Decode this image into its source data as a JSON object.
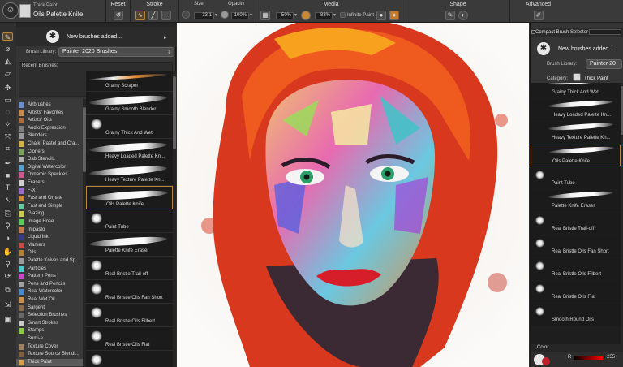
{
  "topbar": {
    "brush_category": "Thick Paint",
    "brush_variant": "Oils Palette Knife",
    "reset_label": "Reset",
    "stroke_label": "Stroke",
    "size_label": "Size",
    "size_value": "33.1",
    "opacity_label": "Opacity",
    "opacity_value": "100%",
    "media_label": "Media",
    "media_value_1": "50%",
    "media_value_2": "83%",
    "infinite_paint_label": "Infinite Paint",
    "shape_label": "Shape",
    "advanced_label": "Advanced"
  },
  "brush_panel": {
    "news_text": "New brushes added...",
    "library_label": "Brush Library:",
    "library_value": "Painter 2020 Brushes",
    "recent_label": "Recent Brushes:",
    "categories": [
      {
        "label": "Airbrushes",
        "color": "#6a8fc9"
      },
      {
        "label": "Artists' Favorites",
        "color": "#c98a4a"
      },
      {
        "label": "Artists' Oils",
        "color": "#b36b3a"
      },
      {
        "label": "Audio Expression",
        "color": "#7f7f7f"
      },
      {
        "label": "Blenders",
        "color": "#9a9a9a"
      },
      {
        "label": "Chalk, Pastel and Cra...",
        "color": "#d6b04e"
      },
      {
        "label": "Cloners",
        "color": "#7aa35b"
      },
      {
        "label": "Dab Stencils",
        "color": "#b0b0b0"
      },
      {
        "label": "Digital Watercolor",
        "color": "#5aa0c9"
      },
      {
        "label": "Dynamic Speckles",
        "color": "#c95a8f"
      },
      {
        "label": "Erasers",
        "color": "#d0d0d0"
      },
      {
        "label": "F-X",
        "color": "#9b6ad0"
      },
      {
        "label": "Fast and Ornate",
        "color": "#d08a3a"
      },
      {
        "label": "Fast and Simple",
        "color": "#6ac9a0"
      },
      {
        "label": "Glazing",
        "color": "#c9c95a"
      },
      {
        "label": "Image Hose",
        "color": "#5ac95a"
      },
      {
        "label": "Impasto",
        "color": "#c97a4a"
      },
      {
        "label": "Liquid Ink",
        "color": "#3a3a8a"
      },
      {
        "label": "Markers",
        "color": "#c94a4a"
      },
      {
        "label": "Oils",
        "color": "#b0803a"
      },
      {
        "label": "Palette Knives and Sp...",
        "color": "#9a9a9a"
      },
      {
        "label": "Particles",
        "color": "#4ac9c9"
      },
      {
        "label": "Pattern Pens",
        "color": "#c94ac9"
      },
      {
        "label": "Pens and Pencils",
        "color": "#a0a0a0"
      },
      {
        "label": "Real Watercolor",
        "color": "#4a8ac9"
      },
      {
        "label": "Real Wet Oil",
        "color": "#c9904a"
      },
      {
        "label": "Sargent",
        "color": "#8a6a4a"
      },
      {
        "label": "Selection Brushes",
        "color": "#6a6a6a"
      },
      {
        "label": "Smart Strokes",
        "color": "#c9c9c9"
      },
      {
        "label": "Stamps",
        "color": "#8ac94a"
      },
      {
        "label": "Sumi-e",
        "color": "#3a3a3a"
      },
      {
        "label": "Texture Cover",
        "color": "#a08060"
      },
      {
        "label": "Texture Source Blendi...",
        "color": "#806040"
      },
      {
        "label": "Thick Paint",
        "color": "#d0a050"
      }
    ],
    "variants": [
      {
        "label": "Grainy Scraper",
        "kind": "stroke-orange"
      },
      {
        "label": "Grainy Smooth Blender",
        "kind": "stroke"
      },
      {
        "label": "Grainy Thick And Wet",
        "kind": "dab"
      },
      {
        "label": "Heavy Loaded Palette Kn...",
        "kind": "stroke"
      },
      {
        "label": "Heavy Texture Palette Kn...",
        "kind": "stroke"
      },
      {
        "label": "Oils Palette Knife",
        "kind": "stroke",
        "selected": true
      },
      {
        "label": "Paint Tube",
        "kind": "dab"
      },
      {
        "label": "Palette Knife Eraser",
        "kind": "stroke"
      },
      {
        "label": "Real Bristle Trail-off",
        "kind": "dab"
      },
      {
        "label": "Real Bristle Oils Fan Short",
        "kind": "dab"
      },
      {
        "label": "Real Bristle Oils Filbert",
        "kind": "dab"
      },
      {
        "label": "Real Bristle Oils Flat",
        "kind": "dab"
      },
      {
        "label": "",
        "kind": "dab"
      }
    ]
  },
  "right_panel": {
    "title": "Compact Brush Selector",
    "news_text": "New brushes added...",
    "library_label": "Brush Library:",
    "library_value": "Painter 20",
    "category_label": "Category:",
    "category_value": "Thick Paint",
    "variants": [
      {
        "label": "Grainy Thick And Wet",
        "kind": "stroke"
      },
      {
        "label": "Heavy Loaded Palette Kn...",
        "kind": "stroke"
      },
      {
        "label": "Heavy Texture Palette Kn...",
        "kind": "stroke"
      },
      {
        "label": "Oils Palette Knife",
        "kind": "stroke",
        "selected": true
      },
      {
        "label": "Paint Tube",
        "kind": "dab"
      },
      {
        "label": "Palette Knife Eraser",
        "kind": "stroke"
      },
      {
        "label": "Real Bristle Trail-off",
        "kind": "dab"
      },
      {
        "label": "Real Bristle Oils Fan Short",
        "kind": "dab"
      },
      {
        "label": "Real Bristle Oils Filbert",
        "kind": "dab"
      },
      {
        "label": "Real Bristle Oils Flat",
        "kind": "dab"
      },
      {
        "label": "Smooth Round Oils",
        "kind": "dab"
      }
    ],
    "color_label": "Color",
    "r_label": "R",
    "r_value": "255"
  },
  "colors": {
    "accent": "#b8863b",
    "panel": "#353535",
    "canvas_bg": "#f6f4f2"
  }
}
